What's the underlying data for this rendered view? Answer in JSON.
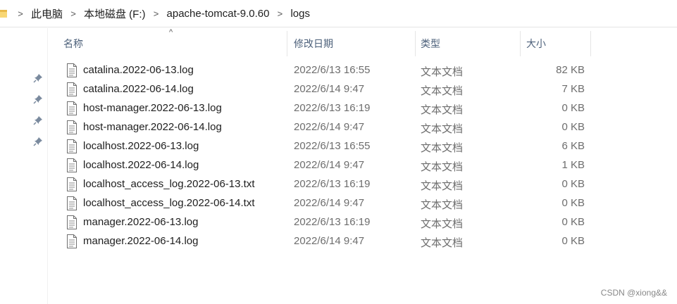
{
  "breadcrumb": {
    "items": [
      "此电脑",
      "本地磁盘 (F:)",
      "apache-tomcat-9.0.60",
      "logs"
    ],
    "separator": ">"
  },
  "columns": {
    "name": "名称",
    "date": "修改日期",
    "type": "类型",
    "size": "大小",
    "sort_indicator": "^"
  },
  "files": [
    {
      "name": "catalina.2022-06-13.log",
      "date": "2022/6/13 16:55",
      "type": "文本文档",
      "size": "82 KB"
    },
    {
      "name": "catalina.2022-06-14.log",
      "date": "2022/6/14 9:47",
      "type": "文本文档",
      "size": "7 KB"
    },
    {
      "name": "host-manager.2022-06-13.log",
      "date": "2022/6/13 16:19",
      "type": "文本文档",
      "size": "0 KB"
    },
    {
      "name": "host-manager.2022-06-14.log",
      "date": "2022/6/14 9:47",
      "type": "文本文档",
      "size": "0 KB"
    },
    {
      "name": "localhost.2022-06-13.log",
      "date": "2022/6/13 16:55",
      "type": "文本文档",
      "size": "6 KB"
    },
    {
      "name": "localhost.2022-06-14.log",
      "date": "2022/6/14 9:47",
      "type": "文本文档",
      "size": "1 KB"
    },
    {
      "name": "localhost_access_log.2022-06-13.txt",
      "date": "2022/6/13 16:19",
      "type": "文本文档",
      "size": "0 KB"
    },
    {
      "name": "localhost_access_log.2022-06-14.txt",
      "date": "2022/6/14 9:47",
      "type": "文本文档",
      "size": "0 KB"
    },
    {
      "name": "manager.2022-06-13.log",
      "date": "2022/6/13 16:19",
      "type": "文本文档",
      "size": "0 KB"
    },
    {
      "name": "manager.2022-06-14.log",
      "date": "2022/6/14 9:47",
      "type": "文本文档",
      "size": "0 KB"
    }
  ],
  "watermark": "CSDN @xiong&&",
  "icons": {
    "address_folder": "folder-icon",
    "pin": "pin-icon",
    "file": "text-file-icon"
  },
  "colors": {
    "header_text": "#4c607a",
    "secondary_text": "#6d6d6d",
    "folder_yellow": "#f8d775"
  }
}
